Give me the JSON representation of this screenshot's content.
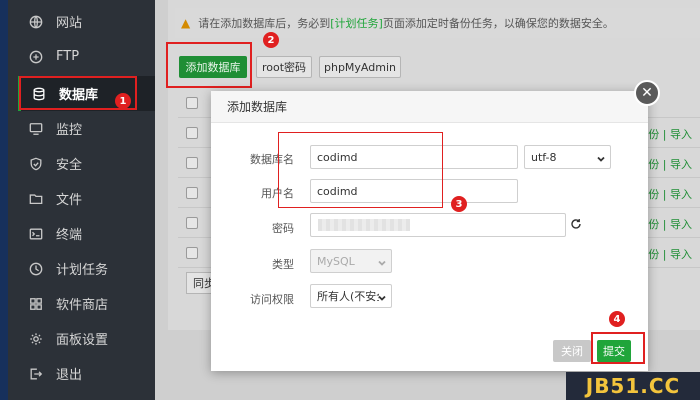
{
  "sidebar": {
    "items": [
      {
        "label": "网站",
        "icon": "globe-icon"
      },
      {
        "label": "FTP",
        "icon": "ftp-icon"
      },
      {
        "label": "数据库",
        "icon": "database-icon",
        "active": true
      },
      {
        "label": "监控",
        "icon": "monitor-icon"
      },
      {
        "label": "安全",
        "icon": "shield-icon"
      },
      {
        "label": "文件",
        "icon": "folder-icon"
      },
      {
        "label": "终端",
        "icon": "terminal-icon"
      },
      {
        "label": "计划任务",
        "icon": "clock-icon"
      },
      {
        "label": "软件商店",
        "icon": "apps-icon"
      },
      {
        "label": "面板设置",
        "icon": "gear-icon"
      },
      {
        "label": "退出",
        "icon": "logout-icon"
      }
    ]
  },
  "alert": {
    "prefix": "请在添加数据库后，务必到",
    "link": "[计划任务]",
    "suffix": "页面添加定时备份任务，以确保您的数据安全。"
  },
  "toolbar": {
    "add_label": "添加数据库",
    "root_label": "root密码",
    "pma_label": "phpMyAdmin"
  },
  "table": {
    "row_ops": "备份 | 导入",
    "row_count": 5
  },
  "sync_label": "同步",
  "modal": {
    "title": "添加数据库",
    "fields": {
      "db_name_label": "数据库名",
      "db_name_value": "codimd",
      "charset_value": "utf-8",
      "user_label": "用户名",
      "user_value": "codimd",
      "password_label": "密码",
      "type_label": "类型",
      "type_value": "MySQL",
      "access_label": "访问权限",
      "access_value": "所有人(不安全)"
    },
    "close_label": "关闭",
    "submit_label": "提交"
  },
  "annotations": [
    "1",
    "2",
    "3",
    "4"
  ],
  "watermark": "JB51.CC",
  "colors": {
    "accent": "#20a53a",
    "highlight": "#e02020",
    "sidebar_bg": "#2c3138"
  }
}
